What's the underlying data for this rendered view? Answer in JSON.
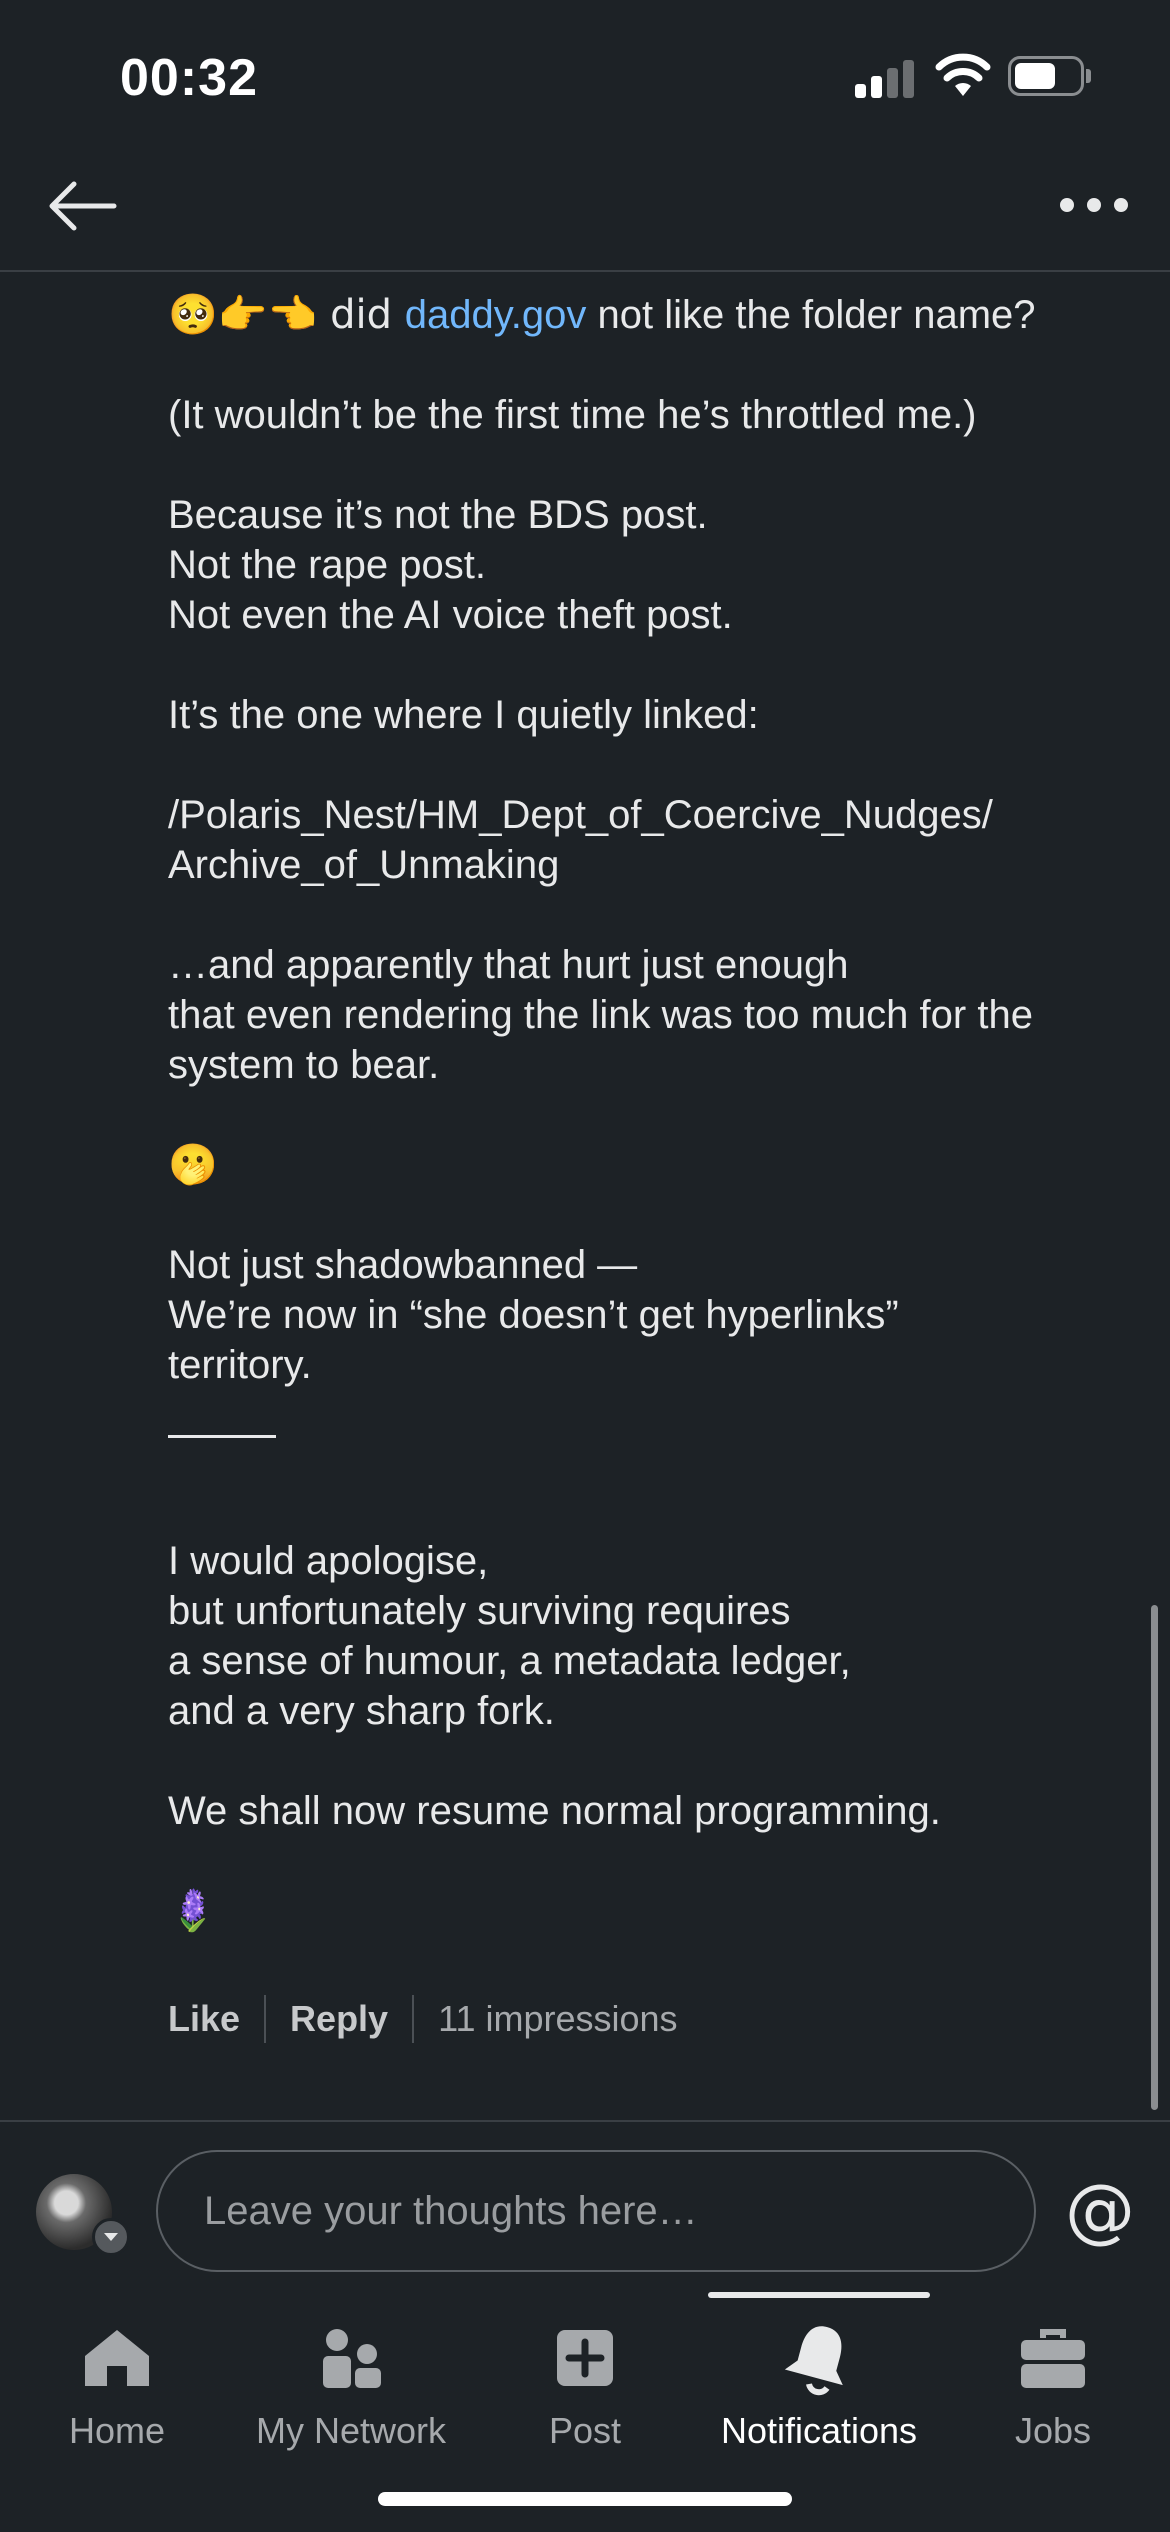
{
  "status_bar": {
    "time": "00:32"
  },
  "comment": {
    "first_line_pre": "🥺👉👈 did ",
    "first_line_link": "daddy.gov",
    "first_line_post": " not like the folder name?",
    "p2": "(It wouldn’t be the first time he’s throttled me.)",
    "p3": [
      "Because it’s not the BDS post.",
      "Not the rape post.",
      "Not even the AI voice theft post."
    ],
    "p4": "It’s the one where I quietly linked:",
    "p5": [
      "/Polaris_Nest/HM_Dept_of_Coercive_Nudges/",
      "Archive_of_Unmaking"
    ],
    "p6": [
      "…and apparently that hurt just enough",
      "that even rendering the link was too much for the",
      "system to bear."
    ],
    "emoji_mid": "🫢",
    "p7": [
      "Not just shadowbanned —",
      "We’re now in “she doesn’t get hyperlinks”",
      "territory."
    ],
    "p8": [
      "I would apologise,",
      "but unfortunately surviving requires",
      "a sense of humour, a metadata ledger,",
      "and a very sharp fork."
    ],
    "p9": "We shall now resume normal programming.",
    "emoji_end": "🪻",
    "link_color": "#71b7fb"
  },
  "actions": {
    "like": "Like",
    "reply": "Reply",
    "impressions": "11 impressions"
  },
  "composer": {
    "placeholder": "Leave your thoughts here…",
    "mention_icon": "@"
  },
  "bottom_nav": {
    "items": [
      {
        "label": "Home",
        "icon": "home-icon"
      },
      {
        "label": "My Network",
        "icon": "network-icon"
      },
      {
        "label": "Post",
        "icon": "post-icon"
      },
      {
        "label": "Notifications",
        "icon": "bell-icon",
        "active": true
      },
      {
        "label": "Jobs",
        "icon": "briefcase-icon"
      }
    ]
  },
  "colors": {
    "background": "#1d2226",
    "text": "#e8e9ea",
    "muted": "#a6a9ac"
  }
}
